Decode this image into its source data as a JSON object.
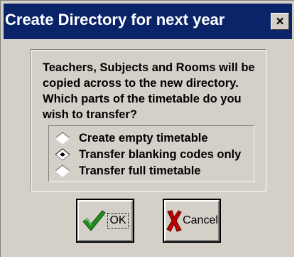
{
  "dialog": {
    "title": "Create Directory for next year",
    "close_label": "×",
    "message_lines": [
      "Teachers, Subjects and Rooms will be",
      "copied across to the new directory.",
      "Which parts of the timetable do you",
      "wish to transfer?"
    ],
    "options": [
      {
        "label": "Create empty timetable",
        "selected": false
      },
      {
        "label": "Transfer blanking codes only",
        "selected": true
      },
      {
        "label": "Transfer full timetable",
        "selected": false
      }
    ],
    "ok_label": "OK",
    "cancel_label": "Cancel",
    "colors": {
      "titlebar": "#0a246a",
      "face": "#d4d0c8",
      "ok_check": "#1e8c1e",
      "cancel_x": "#c00000"
    }
  }
}
